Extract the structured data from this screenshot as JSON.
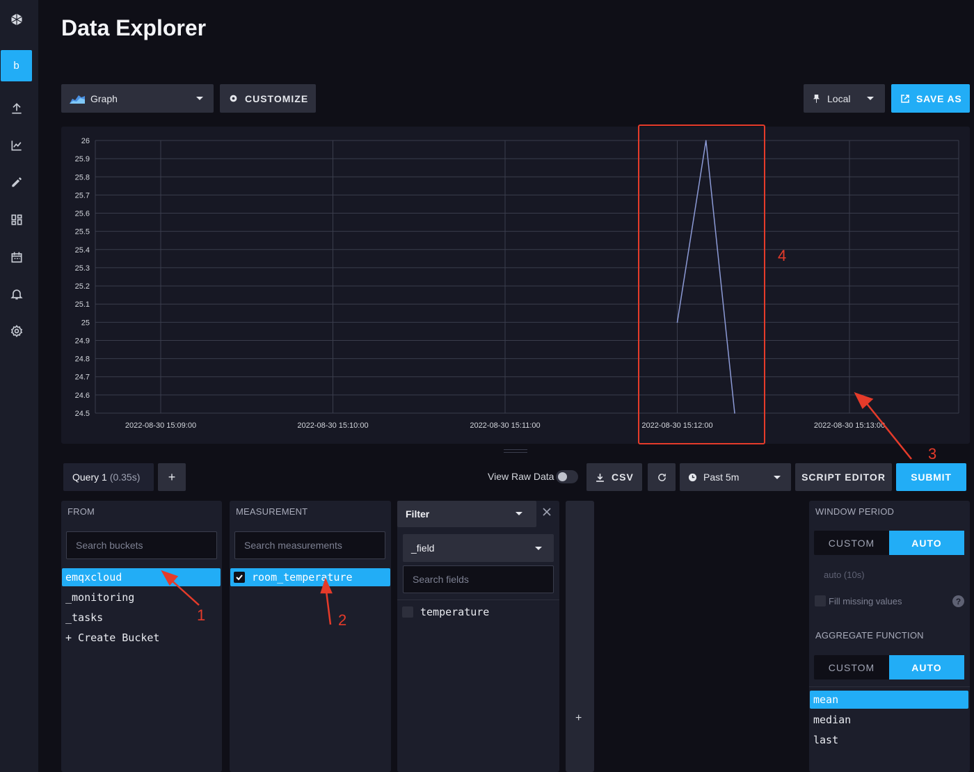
{
  "page": {
    "title": "Data Explorer"
  },
  "sidebar": {
    "org_initial": "b",
    "items": [
      {
        "icon": "upload-icon"
      },
      {
        "icon": "line-chart-icon"
      },
      {
        "icon": "pencil-icon"
      },
      {
        "icon": "dashboards-icon"
      },
      {
        "icon": "calendar-icon"
      },
      {
        "icon": "bell-icon"
      },
      {
        "icon": "gear-icon"
      }
    ]
  },
  "toolbar": {
    "graph_type": "Graph",
    "customize_label": "CUSTOMIZE",
    "timezone": "Local",
    "save_as_label": "SAVE AS"
  },
  "chart_data": {
    "type": "line",
    "title": "",
    "xlabel": "",
    "ylabel": "",
    "ylim": [
      24.5,
      26
    ],
    "yticks": [
      "26",
      "25.9",
      "25.8",
      "25.7",
      "25.6",
      "25.5",
      "25.4",
      "25.3",
      "25.2",
      "25.1",
      "25",
      "24.9",
      "24.8",
      "24.7",
      "24.6",
      "24.5"
    ],
    "xticks": [
      "2022-08-30 15:09:00",
      "2022-08-30 15:10:00",
      "2022-08-30 15:11:00",
      "2022-08-30 15:12:00",
      "2022-08-30 15:13:00"
    ],
    "grid": true,
    "series": [
      {
        "x": [
          "2022-08-30 15:12:00",
          "2022-08-30 15:12:10",
          "2022-08-30 15:12:20"
        ],
        "y": [
          25.0,
          26.0,
          24.5
        ]
      }
    ]
  },
  "annotations": {
    "n1": "1",
    "n2": "2",
    "n3": "3",
    "n4": "4"
  },
  "query_bar": {
    "query_name": "Query 1",
    "query_time": "(0.35s)",
    "add_label": "+",
    "view_raw_label": "View Raw Data",
    "csv_label": "CSV",
    "time_range": "Past 5m",
    "script_editor_label": "SCRIPT EDITOR",
    "submit_label": "SUBMIT"
  },
  "from": {
    "title": "FROM",
    "search_placeholder": "Search buckets",
    "buckets": [
      "emqxcloud",
      "_monitoring",
      "_tasks",
      "+ Create Bucket"
    ]
  },
  "measurement": {
    "title": "MEASUREMENT",
    "search_placeholder": "Search measurements",
    "items": [
      "room_temperature"
    ]
  },
  "filter": {
    "title": "Filter",
    "key": "_field",
    "search_placeholder": "Search fields",
    "items": [
      "temperature"
    ]
  },
  "add_filter_label": "+",
  "window_period": {
    "title": "WINDOW PERIOD",
    "custom_label": "CUSTOM",
    "auto_label": "AUTO",
    "auto_value": "auto (10s)",
    "fill_missing_label": "Fill missing values",
    "help_label": "?"
  },
  "aggregate": {
    "title": "AGGREGATE FUNCTION",
    "custom_label": "CUSTOM",
    "auto_label": "AUTO",
    "functions": [
      "mean",
      "median",
      "last"
    ]
  }
}
